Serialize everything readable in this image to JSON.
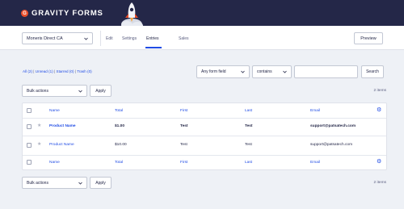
{
  "brand": {
    "text": "GRAVITY FORMS",
    "mark": "G"
  },
  "toolbar": {
    "form_select": "Moneris Direct CA",
    "nav": [
      "Edit",
      "Settings",
      "Entries",
      "Sales"
    ],
    "active": "Entries",
    "preview_label": "Preview"
  },
  "filters": {
    "all": "All",
    "all_count": "(2)",
    "unread": "Unread",
    "unread_count": "(1)",
    "starred": "Starred",
    "starred_count": "(0)",
    "trash": "Trash",
    "trash_count": "(0)",
    "sep": "|"
  },
  "search": {
    "field": "Any form field",
    "operator": "contains",
    "value": "",
    "button": "Search"
  },
  "bulk": {
    "label": "Bulk actions",
    "apply": "Apply",
    "count": "2 items"
  },
  "table": {
    "columns": [
      "Name",
      "Total",
      "First",
      "Last",
      "Email"
    ],
    "rows": [
      {
        "name": "Product Name",
        "total": "$1.00",
        "first": "Test",
        "last": "Test",
        "email": "support@patsatech.com",
        "unread": true
      },
      {
        "name": "Product Name",
        "total": "$10.00",
        "first": "Test",
        "last": "Test",
        "email": "support@patsatech.com",
        "unread": false
      }
    ]
  },
  "colors": {
    "header": "#242748",
    "accent": "#204ce5",
    "logo": "#e94e2a"
  }
}
